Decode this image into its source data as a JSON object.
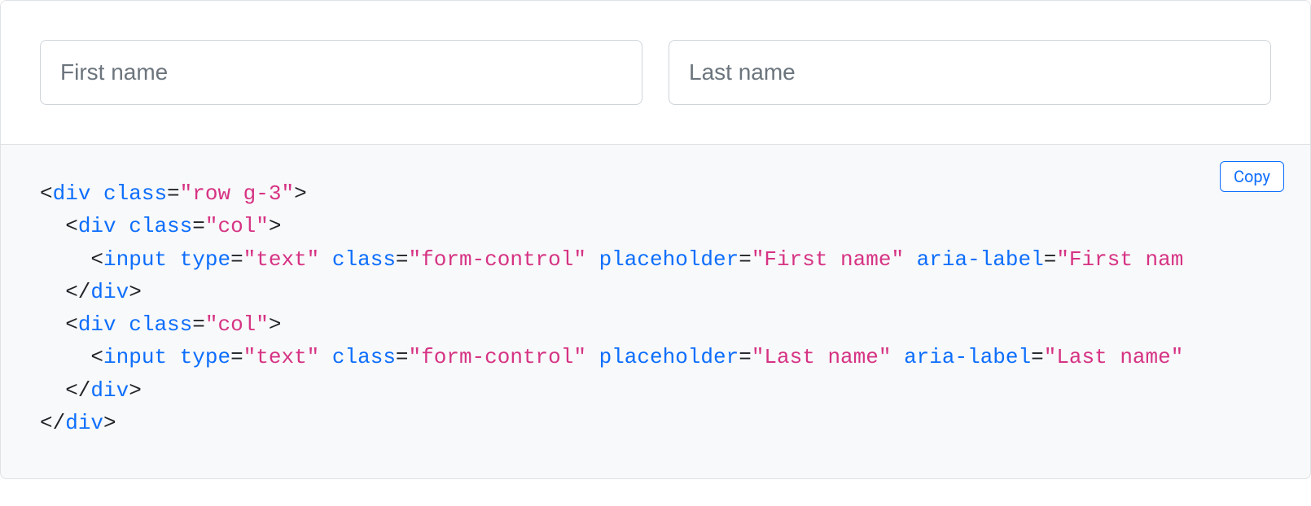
{
  "preview": {
    "first_name_placeholder": "First name",
    "last_name_placeholder": "Last name"
  },
  "code": {
    "copy_label": "Copy",
    "tokens": [
      [
        {
          "t": "p",
          "v": "<"
        },
        {
          "t": "nt",
          "v": "div"
        },
        {
          "t": "p",
          "v": " "
        },
        {
          "t": "na",
          "v": "class"
        },
        {
          "t": "p",
          "v": "="
        },
        {
          "t": "s",
          "v": "\"row g-3\""
        },
        {
          "t": "p",
          "v": ">"
        }
      ],
      [
        {
          "t": "p",
          "v": "  <"
        },
        {
          "t": "nt",
          "v": "div"
        },
        {
          "t": "p",
          "v": " "
        },
        {
          "t": "na",
          "v": "class"
        },
        {
          "t": "p",
          "v": "="
        },
        {
          "t": "s",
          "v": "\"col\""
        },
        {
          "t": "p",
          "v": ">"
        }
      ],
      [
        {
          "t": "p",
          "v": "    <"
        },
        {
          "t": "nt",
          "v": "input"
        },
        {
          "t": "p",
          "v": " "
        },
        {
          "t": "na",
          "v": "type"
        },
        {
          "t": "p",
          "v": "="
        },
        {
          "t": "s",
          "v": "\"text\""
        },
        {
          "t": "p",
          "v": " "
        },
        {
          "t": "na",
          "v": "class"
        },
        {
          "t": "p",
          "v": "="
        },
        {
          "t": "s",
          "v": "\"form-control\""
        },
        {
          "t": "p",
          "v": " "
        },
        {
          "t": "na",
          "v": "placeholder"
        },
        {
          "t": "p",
          "v": "="
        },
        {
          "t": "s",
          "v": "\"First name\""
        },
        {
          "t": "p",
          "v": " "
        },
        {
          "t": "na",
          "v": "aria-label"
        },
        {
          "t": "p",
          "v": "="
        },
        {
          "t": "s",
          "v": "\"First nam"
        }
      ],
      [
        {
          "t": "p",
          "v": "  </"
        },
        {
          "t": "nt",
          "v": "div"
        },
        {
          "t": "p",
          "v": ">"
        }
      ],
      [
        {
          "t": "p",
          "v": "  <"
        },
        {
          "t": "nt",
          "v": "div"
        },
        {
          "t": "p",
          "v": " "
        },
        {
          "t": "na",
          "v": "class"
        },
        {
          "t": "p",
          "v": "="
        },
        {
          "t": "s",
          "v": "\"col\""
        },
        {
          "t": "p",
          "v": ">"
        }
      ],
      [
        {
          "t": "p",
          "v": "    <"
        },
        {
          "t": "nt",
          "v": "input"
        },
        {
          "t": "p",
          "v": " "
        },
        {
          "t": "na",
          "v": "type"
        },
        {
          "t": "p",
          "v": "="
        },
        {
          "t": "s",
          "v": "\"text\""
        },
        {
          "t": "p",
          "v": " "
        },
        {
          "t": "na",
          "v": "class"
        },
        {
          "t": "p",
          "v": "="
        },
        {
          "t": "s",
          "v": "\"form-control\""
        },
        {
          "t": "p",
          "v": " "
        },
        {
          "t": "na",
          "v": "placeholder"
        },
        {
          "t": "p",
          "v": "="
        },
        {
          "t": "s",
          "v": "\"Last name\""
        },
        {
          "t": "p",
          "v": " "
        },
        {
          "t": "na",
          "v": "aria-label"
        },
        {
          "t": "p",
          "v": "="
        },
        {
          "t": "s",
          "v": "\"Last name\""
        }
      ],
      [
        {
          "t": "p",
          "v": "  </"
        },
        {
          "t": "nt",
          "v": "div"
        },
        {
          "t": "p",
          "v": ">"
        }
      ],
      [
        {
          "t": "p",
          "v": "</"
        },
        {
          "t": "nt",
          "v": "div"
        },
        {
          "t": "p",
          "v": ">"
        }
      ]
    ]
  }
}
